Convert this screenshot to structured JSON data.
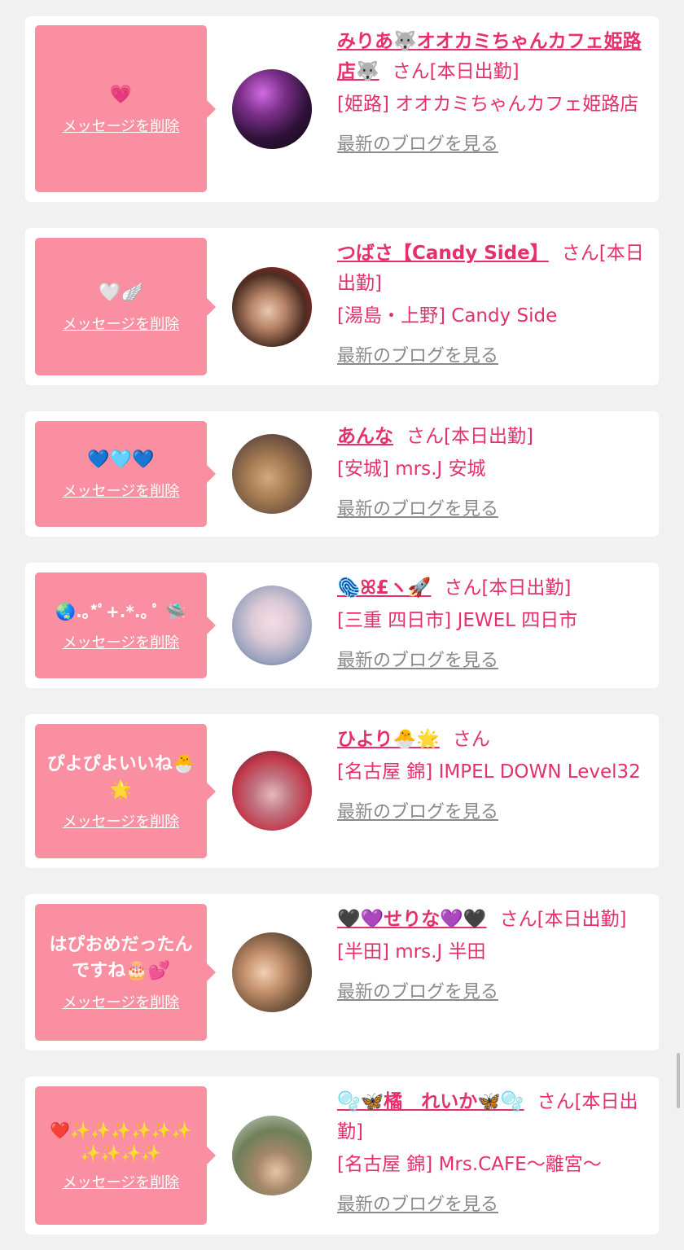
{
  "delete_label": "メッセージを削除",
  "blog_label": "最新のブログを見る",
  "san_label": "さん",
  "cards": [
    {
      "message": "💗",
      "name": "みりあ🐺オオカミちゃんカフェ姫路店🐺",
      "status": "[本日出勤]",
      "shop": "[姫路] オオカミちゃんカフェ姫路店"
    },
    {
      "message": "🤍🪽",
      "name": "つばさ【Candy Side】",
      "status": "[本日出勤]",
      "shop": "[湯島・上野] Candy Side"
    },
    {
      "message": "💙🩵💙",
      "name": "あんな",
      "status": "[本日出勤]",
      "shop": "[安城] mrs.J 安城"
    },
    {
      "message": "🌏.｡*ﾟ+.*.｡ ﾟ 🛸",
      "name": "🫆ꕤ£ヽ🚀",
      "status": "[本日出勤]",
      "shop": "[三重 四日市] JEWEL 四日市"
    },
    {
      "message": "ぴよぴよいいね🐣🌟",
      "name": "ひより🐣🌟",
      "status": "",
      "shop": "[名古屋 錦] IMPEL DOWN Level32"
    },
    {
      "message": "はぴおめだったんですね🎂💕",
      "name": "🖤💜せりな💜🖤",
      "status": "[本日出勤]",
      "shop": "[半田] mrs.J 半田"
    },
    {
      "message": "❤️✨✨✨✨✨✨✨✨✨✨",
      "name": "🫧🦋橘　れいか🦋🫧",
      "status": "[本日出勤]",
      "shop": "[名古屋 錦] Mrs.CAFE〜離宮〜"
    }
  ],
  "colors": {
    "bubble": "#f98fa0",
    "accent": "#e5306b",
    "link_gray": "#8a8a8a",
    "background": "#f1f1f1"
  }
}
